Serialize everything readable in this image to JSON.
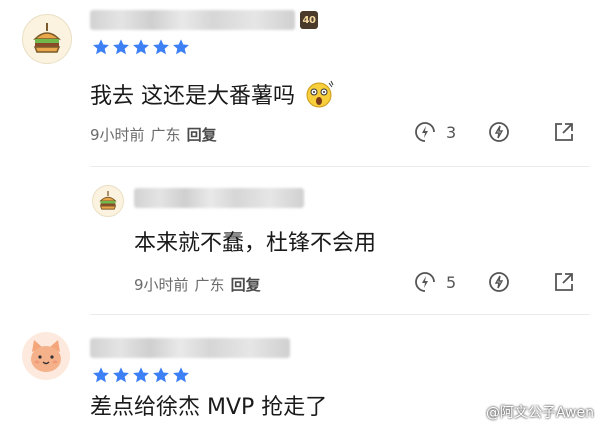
{
  "comments": [
    {
      "text": "我去 这还是大番薯吗",
      "level": "40",
      "rating": 5,
      "time": "9小时前",
      "location": "广东",
      "reply_label": "回复",
      "like_count": "3"
    },
    {
      "text": "本来就不蠢，杜锋不会用",
      "rating": 0,
      "time": "9小时前",
      "location": "广东",
      "reply_label": "回复",
      "like_count": "5"
    },
    {
      "text": "差点给徐杰 MVP 抢走了",
      "rating": 5
    }
  ],
  "watermark": "@阿文公子Awen",
  "colors": {
    "star": "#3d7ff5",
    "icon": "#555555"
  },
  "icons": {
    "like": "lightning-icon",
    "share": "share-icon",
    "more": "external-icon",
    "emoji": "shocked-emoji-icon"
  }
}
